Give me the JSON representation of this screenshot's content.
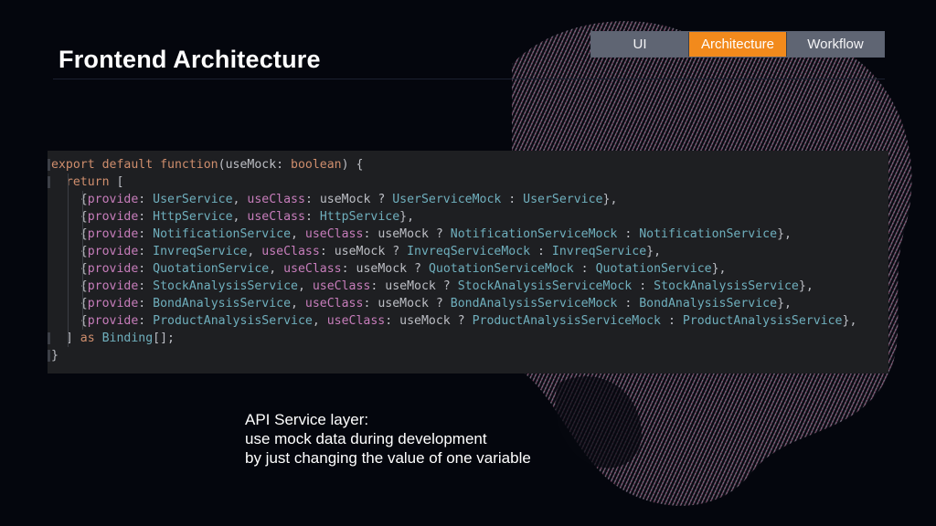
{
  "slide": {
    "title": "Frontend Architecture"
  },
  "tabs": [
    {
      "label": "UI",
      "active": false
    },
    {
      "label": "Architecture",
      "active": true
    },
    {
      "label": "Workflow",
      "active": false
    }
  ],
  "colors": {
    "active_tab": "#f28a1c",
    "inactive_tab": "#5f6573",
    "background": "#04060d",
    "code_background": "#1e1f22"
  },
  "code": {
    "lines": [
      [
        {
          "t": "export default function",
          "c": "kw"
        },
        {
          "t": "(",
          "c": "plain"
        },
        {
          "t": "useMock",
          "c": "plain"
        },
        {
          "t": ": ",
          "c": "plain"
        },
        {
          "t": "boolean",
          "c": "kw"
        },
        {
          "t": ") {",
          "c": "plain"
        }
      ],
      [
        {
          "t": "  return ",
          "c": "kw"
        },
        {
          "t": "[",
          "c": "plain"
        }
      ],
      [
        {
          "t": "    {",
          "c": "plain"
        },
        {
          "t": "provide",
          "c": "prop"
        },
        {
          "t": ": ",
          "c": "plain"
        },
        {
          "t": "UserService",
          "c": "type"
        },
        {
          "t": ", ",
          "c": "plain"
        },
        {
          "t": "useClass",
          "c": "prop"
        },
        {
          "t": ": ",
          "c": "plain"
        },
        {
          "t": "useMock",
          "c": "plain"
        },
        {
          "t": " ? ",
          "c": "plain"
        },
        {
          "t": "UserServiceMock",
          "c": "type"
        },
        {
          "t": " : ",
          "c": "plain"
        },
        {
          "t": "UserService",
          "c": "type"
        },
        {
          "t": "},",
          "c": "plain"
        }
      ],
      [
        {
          "t": "    {",
          "c": "plain"
        },
        {
          "t": "provide",
          "c": "prop"
        },
        {
          "t": ": ",
          "c": "plain"
        },
        {
          "t": "HttpService",
          "c": "type"
        },
        {
          "t": ", ",
          "c": "plain"
        },
        {
          "t": "useClass",
          "c": "prop"
        },
        {
          "t": ": ",
          "c": "plain"
        },
        {
          "t": "HttpService",
          "c": "type"
        },
        {
          "t": "},",
          "c": "plain"
        }
      ],
      [
        {
          "t": "    {",
          "c": "plain"
        },
        {
          "t": "provide",
          "c": "prop"
        },
        {
          "t": ": ",
          "c": "plain"
        },
        {
          "t": "NotificationService",
          "c": "type"
        },
        {
          "t": ", ",
          "c": "plain"
        },
        {
          "t": "useClass",
          "c": "prop"
        },
        {
          "t": ": ",
          "c": "plain"
        },
        {
          "t": "useMock",
          "c": "plain"
        },
        {
          "t": " ? ",
          "c": "plain"
        },
        {
          "t": "NotificationServiceMock",
          "c": "type"
        },
        {
          "t": " : ",
          "c": "plain"
        },
        {
          "t": "NotificationService",
          "c": "type"
        },
        {
          "t": "},",
          "c": "plain"
        }
      ],
      [
        {
          "t": "    {",
          "c": "plain"
        },
        {
          "t": "provide",
          "c": "prop"
        },
        {
          "t": ": ",
          "c": "plain"
        },
        {
          "t": "InvreqService",
          "c": "type"
        },
        {
          "t": ", ",
          "c": "plain"
        },
        {
          "t": "useClass",
          "c": "prop"
        },
        {
          "t": ": ",
          "c": "plain"
        },
        {
          "t": "useMock",
          "c": "plain"
        },
        {
          "t": " ? ",
          "c": "plain"
        },
        {
          "t": "InvreqServiceMock",
          "c": "type"
        },
        {
          "t": " : ",
          "c": "plain"
        },
        {
          "t": "InvreqService",
          "c": "type"
        },
        {
          "t": "},",
          "c": "plain"
        }
      ],
      [
        {
          "t": "    {",
          "c": "plain"
        },
        {
          "t": "provide",
          "c": "prop"
        },
        {
          "t": ": ",
          "c": "plain"
        },
        {
          "t": "QuotationService",
          "c": "type"
        },
        {
          "t": ", ",
          "c": "plain"
        },
        {
          "t": "useClass",
          "c": "prop"
        },
        {
          "t": ": ",
          "c": "plain"
        },
        {
          "t": "useMock",
          "c": "plain"
        },
        {
          "t": " ? ",
          "c": "plain"
        },
        {
          "t": "QuotationServiceMock",
          "c": "type"
        },
        {
          "t": " : ",
          "c": "plain"
        },
        {
          "t": "QuotationService",
          "c": "type"
        },
        {
          "t": "},",
          "c": "plain"
        }
      ],
      [
        {
          "t": "    {",
          "c": "plain"
        },
        {
          "t": "provide",
          "c": "prop"
        },
        {
          "t": ": ",
          "c": "plain"
        },
        {
          "t": "StockAnalysisService",
          "c": "type"
        },
        {
          "t": ", ",
          "c": "plain"
        },
        {
          "t": "useClass",
          "c": "prop"
        },
        {
          "t": ": ",
          "c": "plain"
        },
        {
          "t": "useMock",
          "c": "plain"
        },
        {
          "t": " ? ",
          "c": "plain"
        },
        {
          "t": "StockAnalysisServiceMock",
          "c": "type"
        },
        {
          "t": " : ",
          "c": "plain"
        },
        {
          "t": "StockAnalysisService",
          "c": "type"
        },
        {
          "t": "},",
          "c": "plain"
        }
      ],
      [
        {
          "t": "    {",
          "c": "plain"
        },
        {
          "t": "provide",
          "c": "prop"
        },
        {
          "t": ": ",
          "c": "plain"
        },
        {
          "t": "BondAnalysisService",
          "c": "type"
        },
        {
          "t": ", ",
          "c": "plain"
        },
        {
          "t": "useClass",
          "c": "prop"
        },
        {
          "t": ": ",
          "c": "plain"
        },
        {
          "t": "useMock",
          "c": "plain"
        },
        {
          "t": " ? ",
          "c": "plain"
        },
        {
          "t": "BondAnalysisServiceMock",
          "c": "type"
        },
        {
          "t": " : ",
          "c": "plain"
        },
        {
          "t": "BondAnalysisService",
          "c": "type"
        },
        {
          "t": "},",
          "c": "plain"
        }
      ],
      [
        {
          "t": "    {",
          "c": "plain"
        },
        {
          "t": "provide",
          "c": "prop"
        },
        {
          "t": ": ",
          "c": "plain"
        },
        {
          "t": "ProductAnalysisService",
          "c": "type"
        },
        {
          "t": ", ",
          "c": "plain"
        },
        {
          "t": "useClass",
          "c": "prop"
        },
        {
          "t": ": ",
          "c": "plain"
        },
        {
          "t": "useMock",
          "c": "plain"
        },
        {
          "t": " ? ",
          "c": "plain"
        },
        {
          "t": "ProductAnalysisServiceMock",
          "c": "type"
        },
        {
          "t": " : ",
          "c": "plain"
        },
        {
          "t": "ProductAnalysisService",
          "c": "type"
        },
        {
          "t": "},",
          "c": "plain"
        }
      ],
      [
        {
          "t": "  ] ",
          "c": "plain"
        },
        {
          "t": "as ",
          "c": "kw"
        },
        {
          "t": "Binding",
          "c": "type"
        },
        {
          "t": "[];",
          "c": "plain"
        }
      ],
      [
        {
          "t": "}",
          "c": "plain"
        }
      ]
    ]
  },
  "caption": {
    "line1": "API Service layer:",
    "line2": "use mock data during development",
    "line3": "by just changing the value of one variable"
  }
}
